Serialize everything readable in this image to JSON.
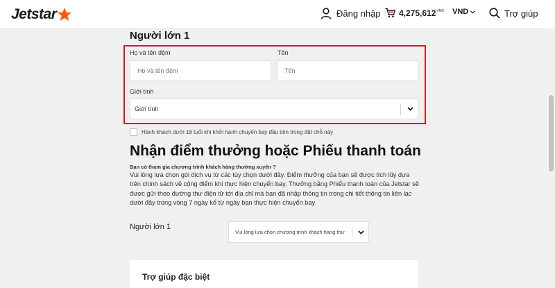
{
  "header": {
    "brand": "Jetstar",
    "login_label": "Đăng nhập",
    "cart_amount": "4,275,612",
    "cart_unit": "VND",
    "currency": "VND",
    "help_label": "Trợ giúp",
    "brand_color": "#ff5a00"
  },
  "passenger": {
    "title": "Người lớn 1",
    "middle_name_label": "Họ và tên đệm",
    "middle_name_placeholder": "Họ và tên đệm",
    "first_name_label": "Tên",
    "first_name_placeholder": "Tên",
    "gender_label": "Giới tính",
    "gender_value": "Giới tính",
    "highlight_color": "#e0141e"
  },
  "minor_checkbox_label": "Hành khách dưới 18 tuổi khi khởi hành chuyến bay đầu tiên trong đặt chỗ này",
  "rewards": {
    "title": "Nhận điểm thưởng hoặc Phiếu thanh toán",
    "question": "Bạn có tham gia chương trình khách hàng thường xuyên ?",
    "description": "Vui lòng lựa chọn gói dịch vụ từ các tùy chọn dưới đây. Điểm thưởng của bạn sẽ được tích lũy dựa trên chính sách về cộng điểm khi thực hiện chuyến bay. Thưởng bằng Phiếu thanh toán của Jetstar sẽ được gửi theo đường thư điện tử tới địa chỉ mà bạn đã nhập thông tin trong chi tiết thông tin liên lạc dưới đây trong vòng 7 ngày kể từ ngày bạn thực hiện chuyến bay",
    "passenger_label": "Người lớn 1",
    "program_placeholder": "Vui lòng lựa chọn chương trình khách hàng thư"
  },
  "special_help": {
    "title": "Trợ giúp đặc biệt"
  }
}
